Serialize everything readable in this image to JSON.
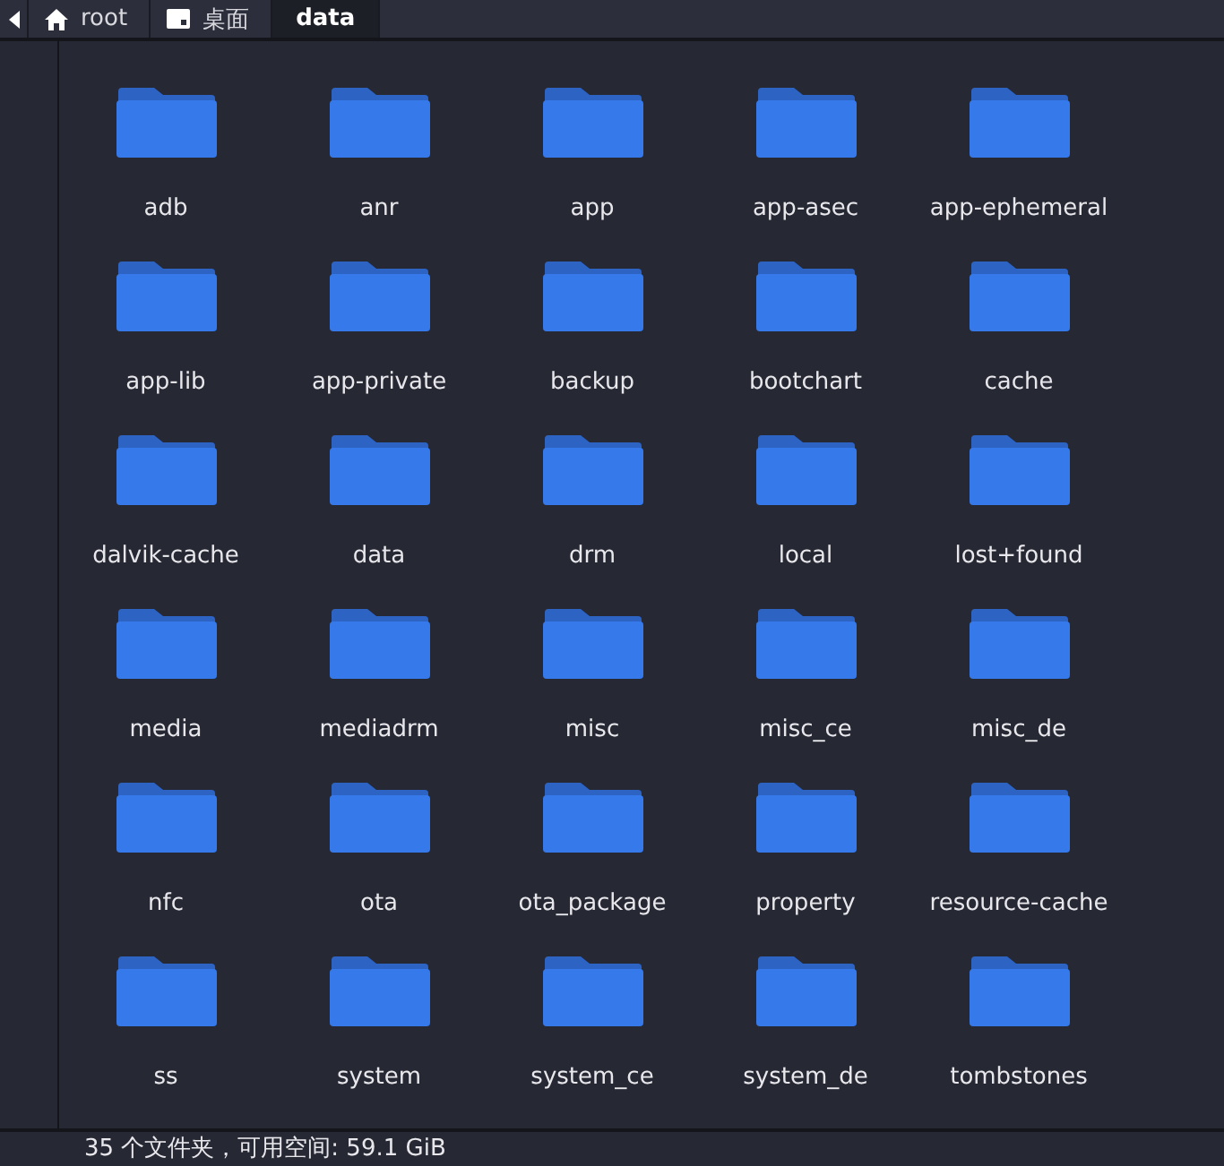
{
  "tabs": [
    {
      "label": "root",
      "kind": "home",
      "selected": false
    },
    {
      "label": "桌面",
      "kind": "desktop",
      "selected": false
    },
    {
      "label": "data",
      "kind": "plain",
      "selected": true
    }
  ],
  "folders": [
    "adb",
    "anr",
    "app",
    "app-asec",
    "app-ephemeral",
    "app-lib",
    "app-private",
    "backup",
    "bootchart",
    "cache",
    "dalvik-cache",
    "data",
    "drm",
    "local",
    "lost+found",
    "media",
    "mediadrm",
    "misc",
    "misc_ce",
    "misc_de",
    "nfc",
    "ota",
    "ota_package",
    "property",
    "resource-cache",
    "ss",
    "system",
    "system_ce",
    "system_de",
    "tombstones"
  ],
  "status_bar": "35 个文件夹，可用空间: 59.1 GiB"
}
